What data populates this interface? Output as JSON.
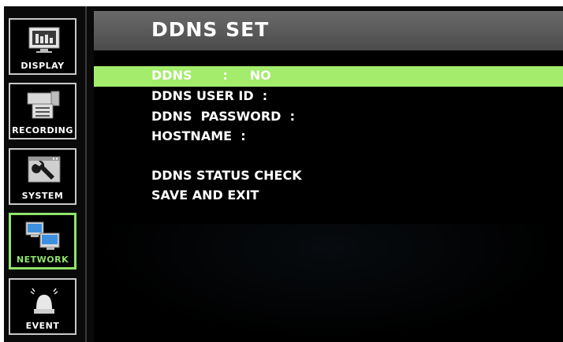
{
  "sidebar": {
    "items": [
      {
        "label": "DISPLAY",
        "icon": "display-icon",
        "active": false
      },
      {
        "label": "RECORDING",
        "icon": "camera-icon",
        "active": false
      },
      {
        "label": "SYSTEM",
        "icon": "wrench-icon",
        "active": false
      },
      {
        "label": "NETWORK",
        "icon": "network-icon",
        "active": true
      },
      {
        "label": "EVENT",
        "icon": "alarm-icon",
        "active": false
      }
    ]
  },
  "panel": {
    "title": "DDNS  SET",
    "menu": [
      {
        "label": "DDNS       :     NO",
        "selected": true
      },
      {
        "label": "DDNS USER ID  :",
        "selected": false
      },
      {
        "label": "DDNS  PASSWORD  :",
        "selected": false
      },
      {
        "label": "HOSTNAME  :",
        "selected": false
      },
      {
        "label": "DDNS STATUS CHECK",
        "selected": false
      },
      {
        "label": "SAVE AND EXIT",
        "selected": false
      }
    ]
  },
  "colors": {
    "accent": "#a3ec6c",
    "active_border": "#90e36a",
    "title_bar": "#5a5a5a",
    "background": "#000000"
  }
}
